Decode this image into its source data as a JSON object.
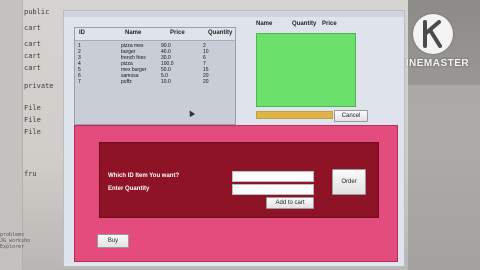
{
  "ide": {
    "lines": [
      "public",
      "cart",
      "cart",
      "cart",
      "cart",
      "cart",
      "private",
      "File",
      "File",
      "File",
      "fru"
    ],
    "bottom_text": [
      "problems",
      "JG_worksho",
      "Explorer"
    ]
  },
  "watermark": {
    "text": "KINEMASTER"
  },
  "product_table": {
    "headers": [
      "ID",
      "Name",
      "Price",
      "Quantity"
    ],
    "rows": [
      [
        "1",
        "pizza mex",
        "90.0",
        "2"
      ],
      [
        "2",
        "burger",
        "40.0",
        "10"
      ],
      [
        "3",
        "french fries",
        "30.0",
        "6"
      ],
      [
        "4",
        "pizza",
        "100.0",
        "7"
      ],
      [
        "5",
        "mex burger",
        "50.0",
        "15"
      ],
      [
        "6",
        "samosa",
        "5.0",
        "20"
      ],
      [
        "7",
        "puffz",
        "10.0",
        "20"
      ]
    ]
  },
  "cart_table": {
    "headers": [
      "Name",
      "Quantity",
      "Price"
    ]
  },
  "cancel_button": "Cancel",
  "progress": {
    "fraction": 1.0,
    "color": "#e0b34a"
  },
  "order_form": {
    "id_label": "Which ID Item You want?",
    "quantity_label": "Enter  Quantity",
    "id_value": "",
    "quantity_value": "",
    "order_button": "Order",
    "add_to_cart_button": "Add to cart",
    "buy_button": "Buy"
  },
  "colors": {
    "panel": "#e34c7d",
    "inner_panel": "#8e1326",
    "cart_area": "#6be06a"
  }
}
